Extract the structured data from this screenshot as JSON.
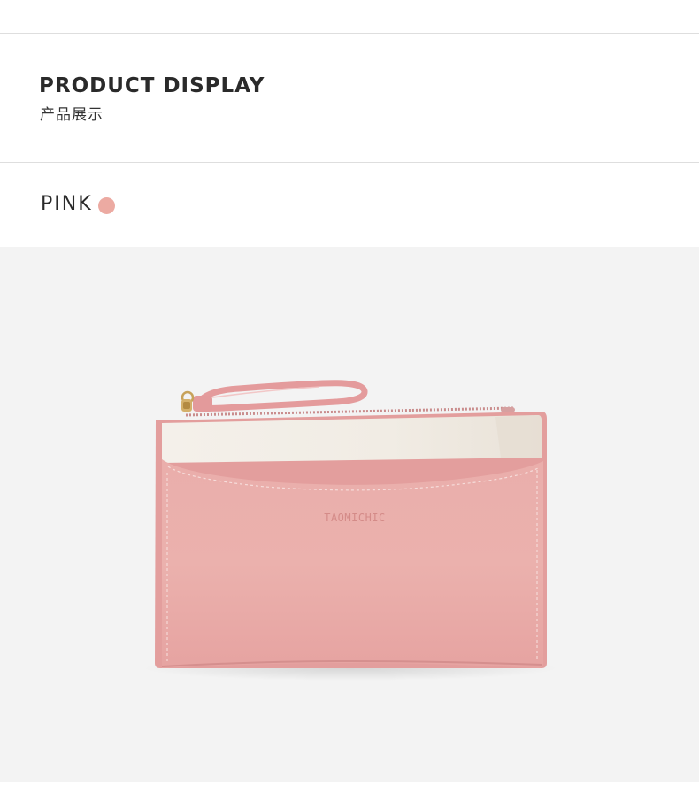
{
  "header": {
    "title": "PRODUCT DISPLAY",
    "subtitle": "产品展示"
  },
  "color_option": {
    "label": "PINK",
    "swatch_color": "#ecaaa2"
  },
  "product": {
    "brand_emboss": "TAOMICHIC",
    "body_color": "#e9a7a5",
    "accent_color": "#f3efe9",
    "background_color": "#f3f3f3"
  }
}
